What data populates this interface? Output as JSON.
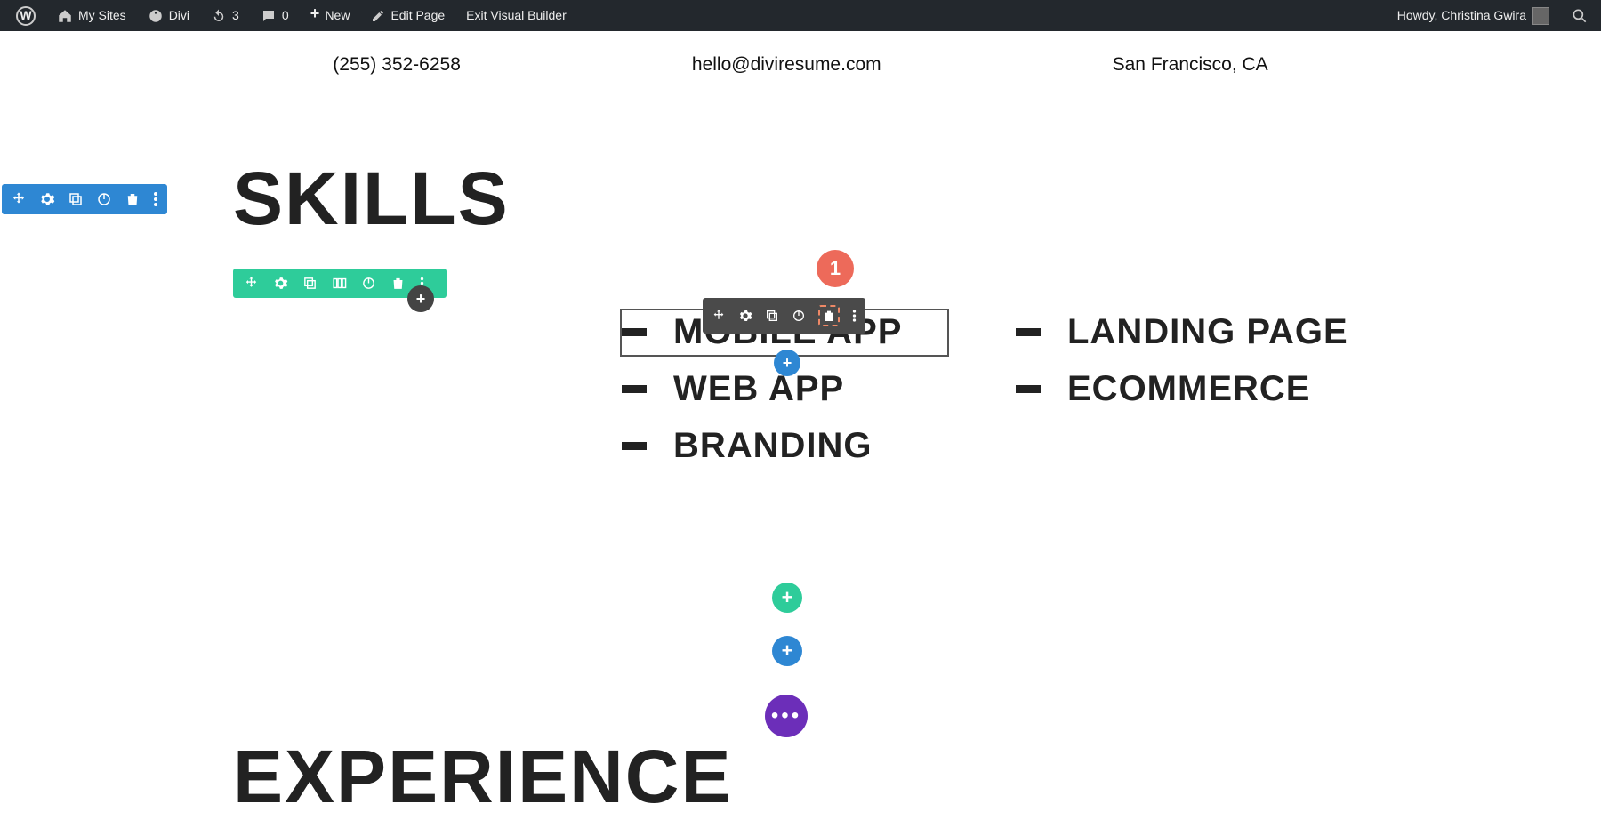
{
  "adminbar": {
    "my_sites": "My Sites",
    "site": "Divi",
    "updates": "3",
    "comments": "0",
    "new": "New",
    "edit_page": "Edit Page",
    "exit_vb": "Exit Visual Builder",
    "howdy": "Howdy, Christina Gwira"
  },
  "contact": {
    "phone": "(255) 352-6258",
    "email": "hello@diviresume.com",
    "loc": "San Francisco, CA"
  },
  "headings": {
    "skills": "SKILLS",
    "experience": "EXPERIENCE"
  },
  "skills": {
    "c2": [
      "MOBILE APP",
      "WEB APP",
      "BRANDING"
    ],
    "c3": [
      "LANDING PAGE",
      "ECOMMERCE"
    ]
  },
  "callout": "1"
}
